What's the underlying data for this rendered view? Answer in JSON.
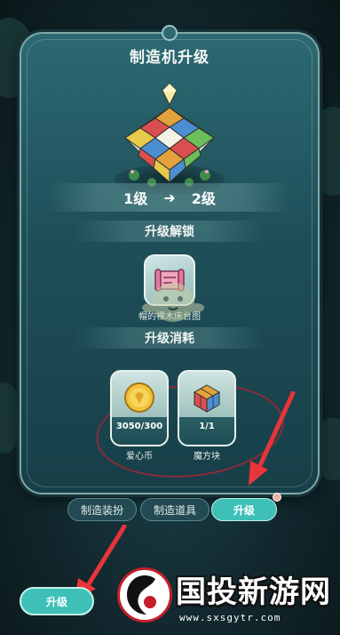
{
  "panel": {
    "title": "制造机升级",
    "level": {
      "from": "1级",
      "to": "2级"
    },
    "unlock_section": "升级解锁",
    "unlock_item": {
      "label": "帽的裸木床台图",
      "icon": "blueprint-icon"
    },
    "cost_section": "升级消耗",
    "costs": [
      {
        "count": "3050/300",
        "name": "爱心币",
        "icon": "heart-coin-icon"
      },
      {
        "count": "1/1",
        "name": "魔方块",
        "icon": "magic-cube-icon"
      }
    ]
  },
  "tabs": [
    {
      "label": "制造装扮",
      "active": false
    },
    {
      "label": "制造道具",
      "active": false
    },
    {
      "label": "升级",
      "active": true
    }
  ],
  "bottom_button": {
    "label": "升级"
  },
  "watermark": {
    "text": "国投新游网",
    "url": "www.sxsgytr.com"
  },
  "colors": {
    "accent": "#3ec0b6",
    "panel": "#1e4f59",
    "highlight": "#e8343a"
  }
}
